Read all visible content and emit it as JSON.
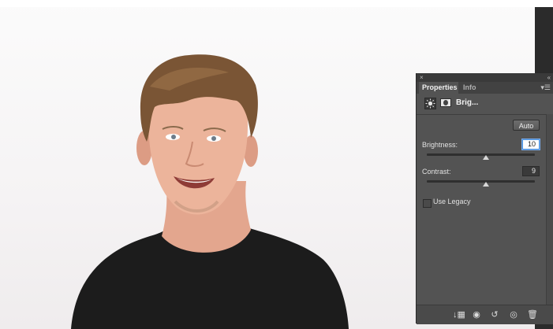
{
  "panel": {
    "close_glyph": "×",
    "collapse_glyph": "‹‹",
    "tabs": [
      {
        "label": "Properties",
        "active": true
      },
      {
        "label": "Info",
        "active": false
      }
    ],
    "menu_glyph": "▾☰",
    "adjustment_name": "Brig...",
    "auto_label": "Auto",
    "brightness": {
      "label": "Brightness:",
      "value": "10",
      "slider_position": 0.55
    },
    "contrast": {
      "label": "Contrast:",
      "value": "9",
      "slider_position": 0.55
    },
    "use_legacy": {
      "label": "Use Legacy",
      "checked": false
    }
  },
  "colors": {
    "panel_bg": "#535353",
    "focus_ring": "#4a8fd9"
  },
  "icons": [
    "brightness-adjustment-icon",
    "layer-mask-icon",
    "clip-to-layer-icon",
    "view-previous-icon",
    "reset-icon",
    "visibility-icon",
    "delete-icon"
  ]
}
